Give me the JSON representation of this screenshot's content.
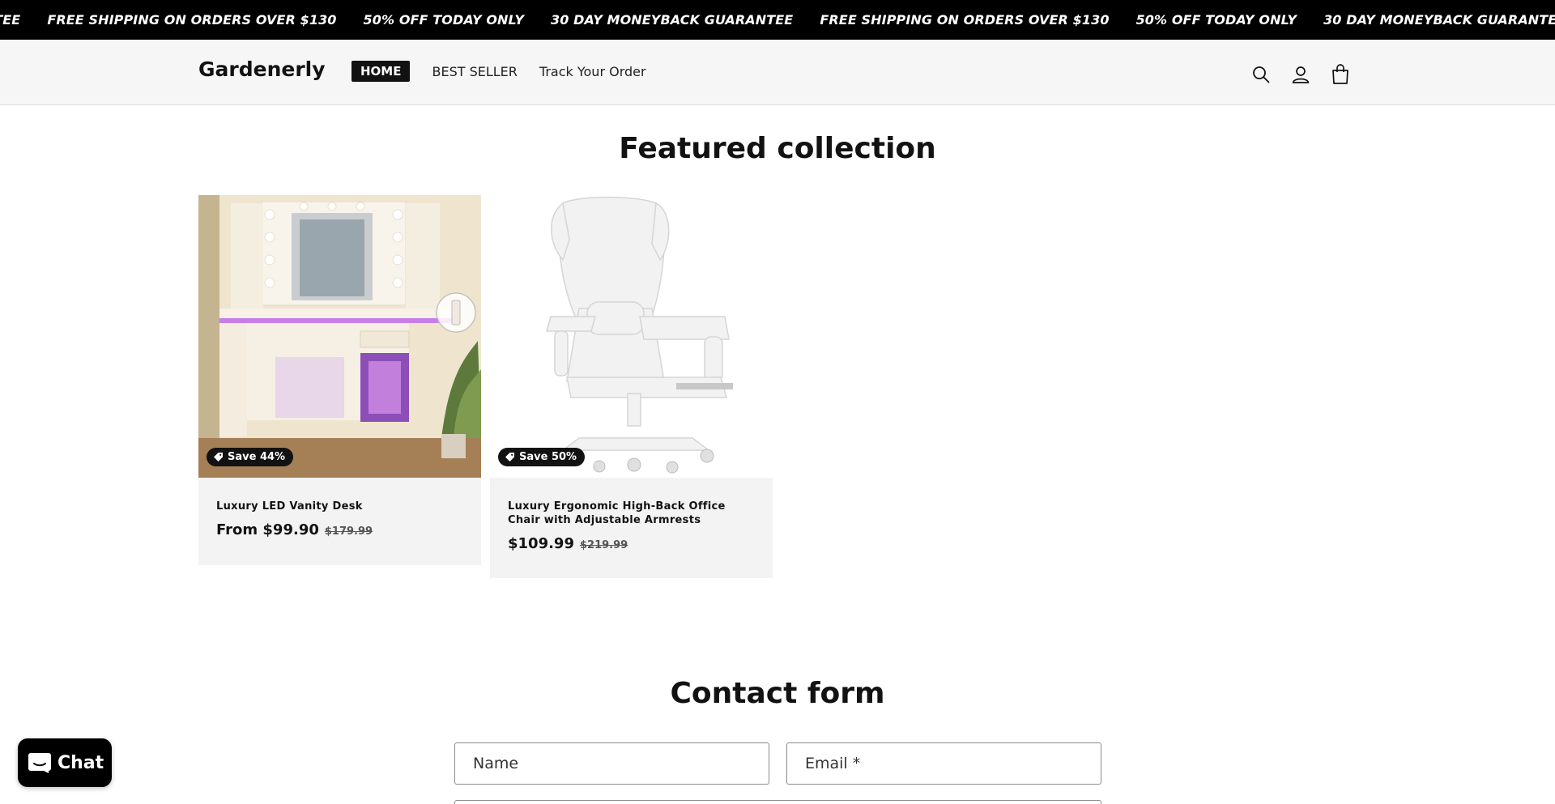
{
  "announcement": {
    "items": [
      "30 DAY MONEYBACK GUARANTEE",
      "FREE SHIPPING ON ORDERS OVER $130",
      "50% OFF TODAY ONLY",
      "30 DAY MONEYBACK GUARANTEE",
      "FREE SHIPPING ON ORDERS OVER $130",
      "50% OFF TODAY ONLY",
      "30 DAY MONEYBACK GUARANTEE"
    ]
  },
  "header": {
    "logo": "Gardenerly",
    "nav": [
      "HOME",
      "BEST SELLER",
      "Track Your Order"
    ],
    "active_nav": "HOME",
    "icons": [
      "search-icon",
      "account-icon",
      "cart-icon"
    ]
  },
  "featured": {
    "title": "Featured collection",
    "products": [
      {
        "badge": "Save 44%",
        "title": "Luxury LED Vanity Desk",
        "price": "From $99.90",
        "compare_price": "$179.99"
      },
      {
        "badge": "Save 50%",
        "title": "Luxury Ergonomic High-Back Office Chair with Adjustable Armrests",
        "price": "$109.99",
        "compare_price": "$219.99"
      }
    ]
  },
  "contact": {
    "title": "Contact form",
    "name_placeholder": "Name",
    "email_placeholder": "Email *"
  },
  "chat": {
    "label": "Chat"
  },
  "colors": {
    "announcement_bg": "#000000",
    "header_bg": "#f6f6f6",
    "card_bg": "#f3f3f3",
    "badge_bg": "#121212",
    "text": "#121212"
  }
}
